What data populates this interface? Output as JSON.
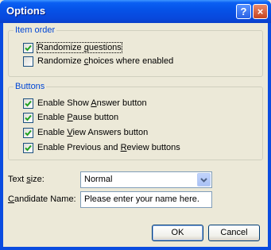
{
  "window": {
    "title": "Options",
    "help_label": "?",
    "close_label": "×"
  },
  "item_order": {
    "legend": "Item order",
    "randomize_questions": {
      "pre": "Randomize ",
      "key": "q",
      "post": "uestions",
      "checked": true
    },
    "randomize_choices": {
      "pre": "Randomize ",
      "key": "c",
      "post": "hoices where enabled",
      "checked": false
    }
  },
  "buttons_group": {
    "legend": "Buttons",
    "show_answer": {
      "pre": "Enable Show ",
      "key": "A",
      "post": "nswer button",
      "checked": true
    },
    "pause": {
      "pre": "Enable ",
      "key": "P",
      "post": "ause button",
      "checked": true
    },
    "view_answers": {
      "pre": "Enable ",
      "key": "V",
      "post": "iew Answers button",
      "checked": true
    },
    "prev_review": {
      "pre": "Enable Previous and ",
      "key": "R",
      "post": "eview buttons",
      "checked": true
    }
  },
  "text_size": {
    "pre": "Text ",
    "key": "s",
    "post": "ize:",
    "value": "Normal"
  },
  "candidate_name": {
    "pre": "",
    "key": "C",
    "post": "andidate Name:",
    "value": "Please enter your name here."
  },
  "ok_label": "OK",
  "cancel_label": "Cancel",
  "colors": {
    "titlebar": "#0653e8",
    "dialog_bg": "#ece9d8",
    "legend_text": "#0046d5"
  }
}
